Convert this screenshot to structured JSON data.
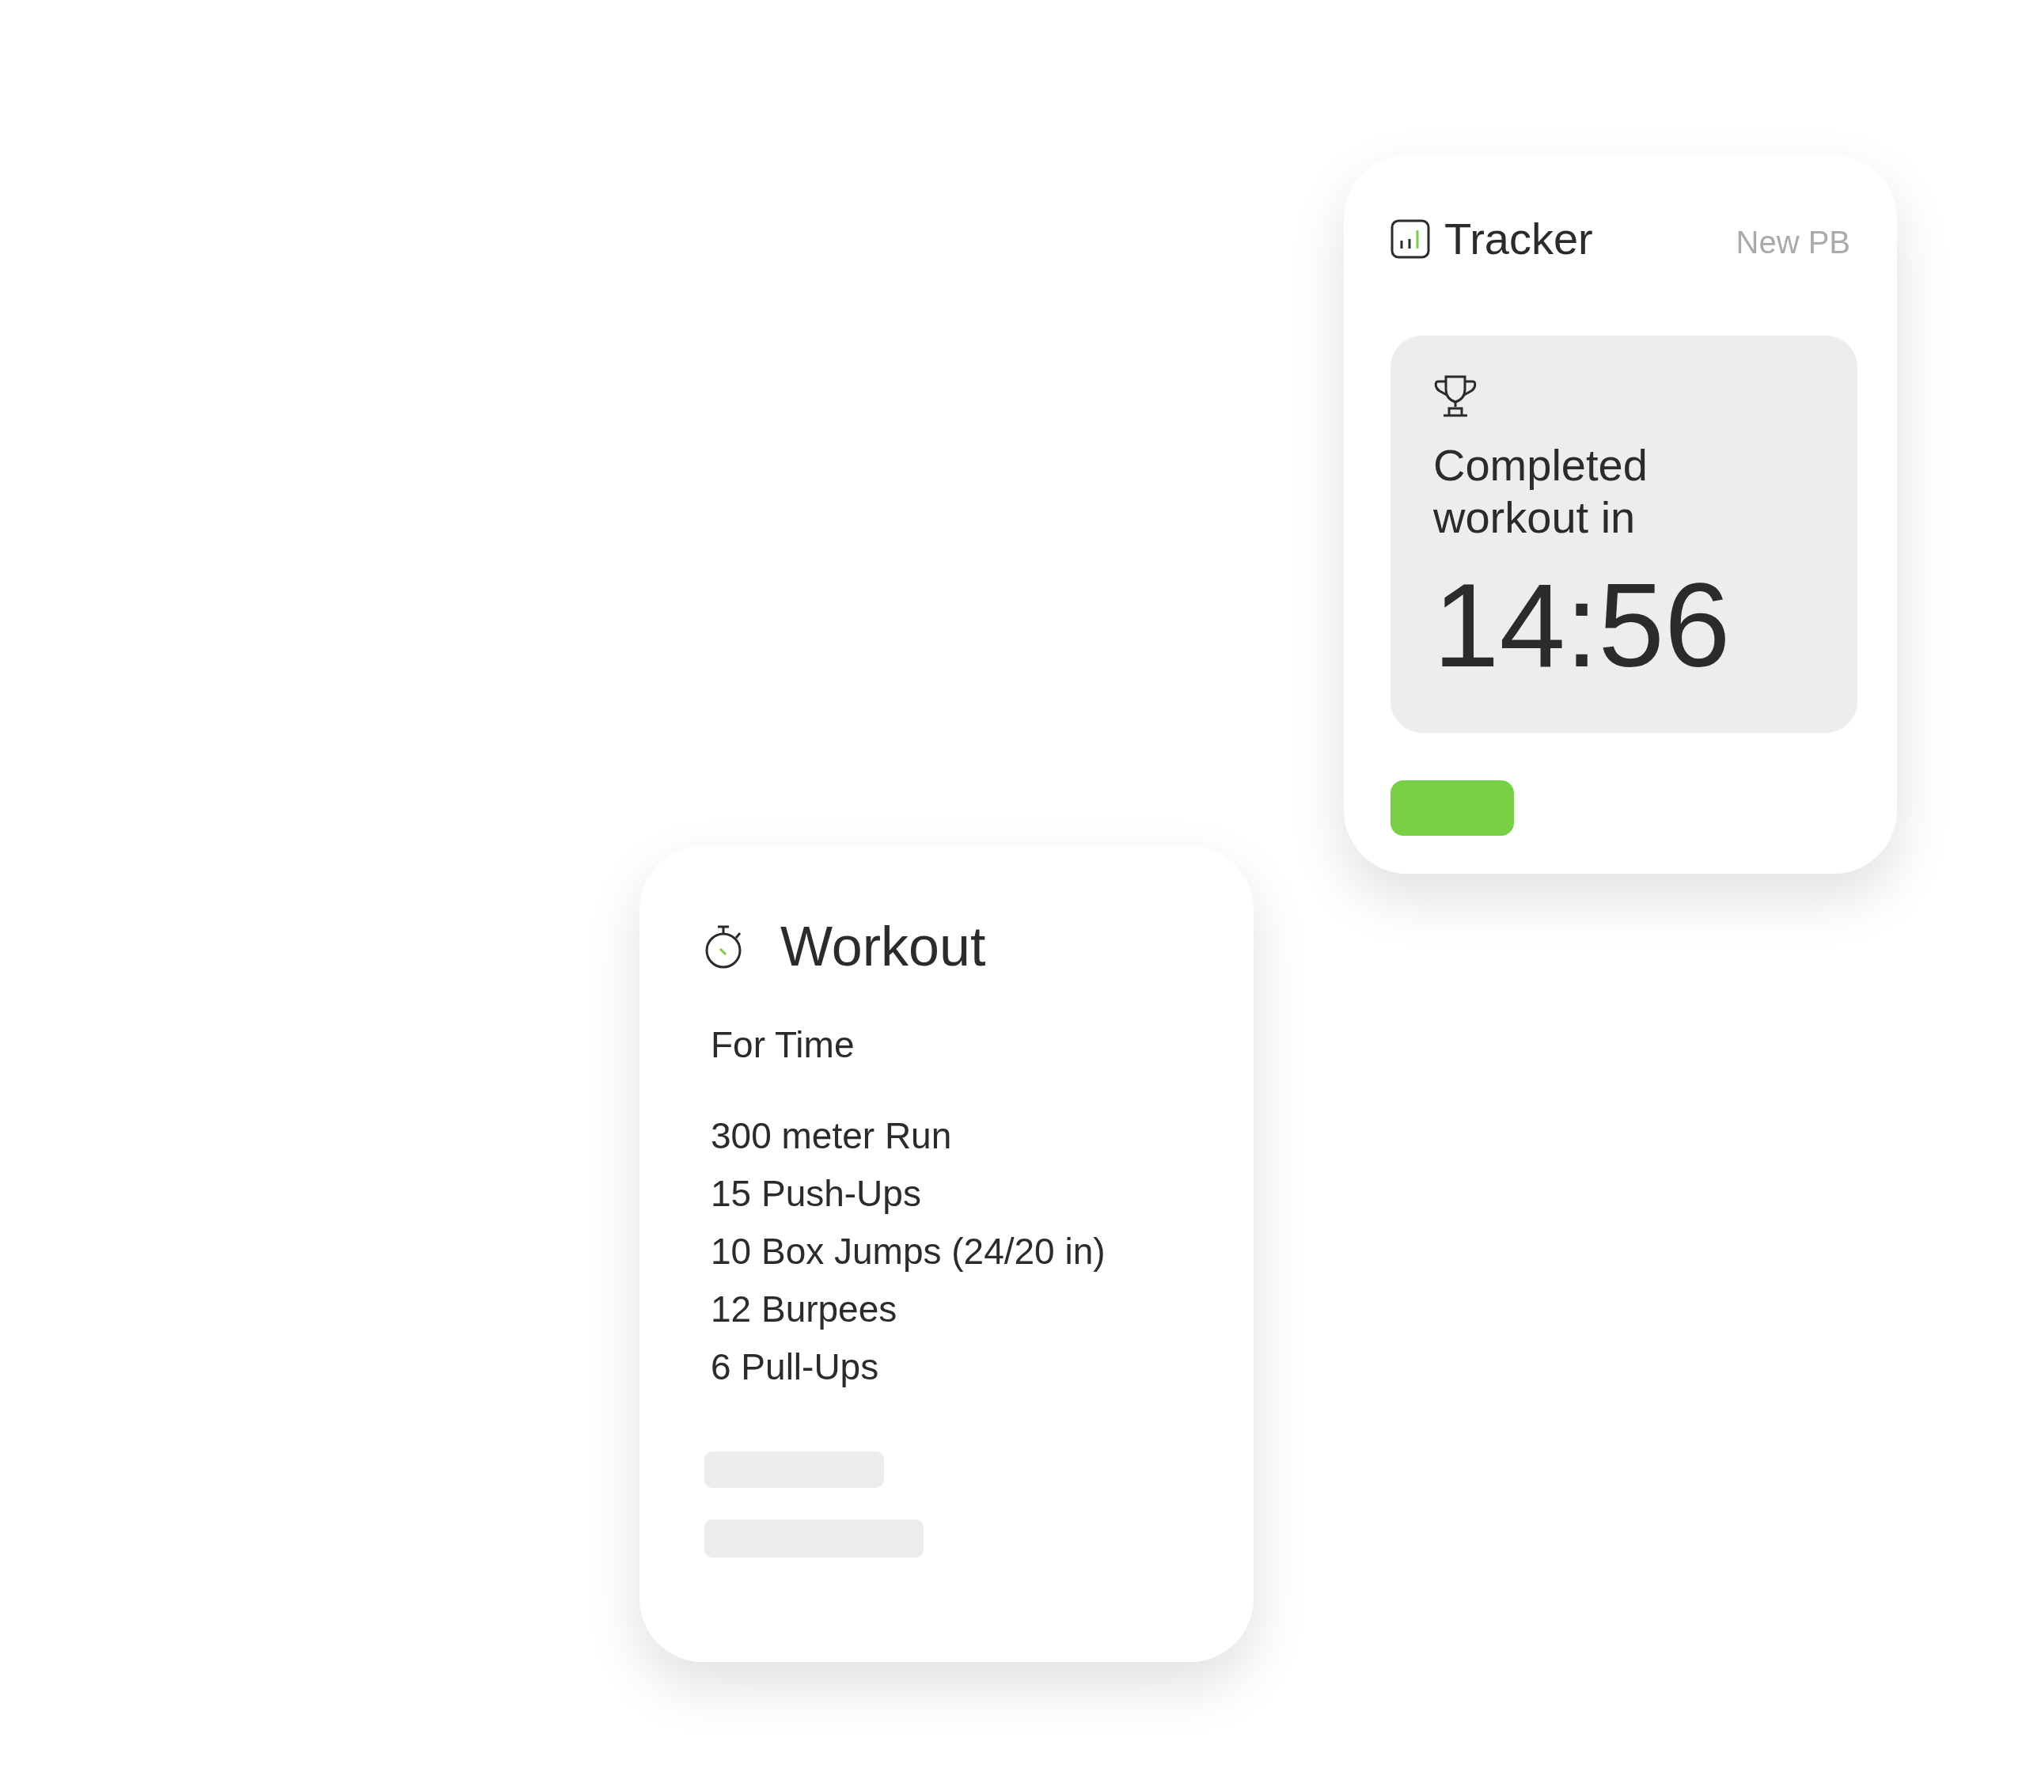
{
  "tracker": {
    "title": "Tracker",
    "badge": "New PB",
    "message": "Completed workout in",
    "time": "14:56"
  },
  "workout": {
    "title": "Workout",
    "format": "For Time",
    "movements": [
      "300 meter Run",
      "15 Push-Ups",
      "10 Box Jumps (24/20 in)",
      "12 Burpees",
      "6 Pull-Ups"
    ]
  }
}
